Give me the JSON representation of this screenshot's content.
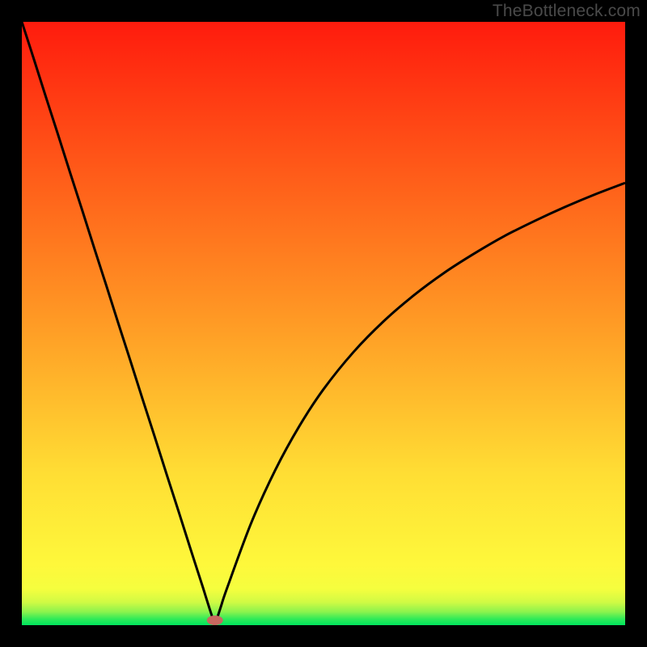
{
  "watermark": "TheBottleneck.com",
  "chart_data": {
    "type": "line",
    "title": "",
    "xlabel": "",
    "ylabel": "",
    "xlim": [
      0,
      100
    ],
    "ylim": [
      0,
      100
    ],
    "x": [
      0,
      2,
      4,
      6,
      8,
      10,
      12,
      14,
      16,
      18,
      20,
      22,
      24,
      26,
      28,
      30,
      31,
      32,
      33,
      34,
      38,
      42,
      46,
      50,
      55,
      60,
      65,
      70,
      75,
      80,
      85,
      90,
      95,
      100
    ],
    "y": [
      100,
      93.8,
      87.5,
      81.3,
      75.0,
      68.8,
      62.5,
      56.3,
      50.0,
      43.8,
      37.5,
      31.3,
      25.0,
      18.8,
      12.5,
      6.3,
      3.1,
      0.0,
      3.1,
      6.1,
      16.9,
      25.7,
      33.0,
      39.1,
      45.3,
      50.4,
      54.7,
      58.4,
      61.6,
      64.5,
      67.0,
      69.3,
      71.4,
      73.3
    ],
    "background_gradient_stops": [
      {
        "offset": 0.0,
        "color": "#00e55e"
      },
      {
        "offset": 0.01,
        "color": "#2eea58"
      },
      {
        "offset": 0.022,
        "color": "#8bf34d"
      },
      {
        "offset": 0.038,
        "color": "#d0fa44"
      },
      {
        "offset": 0.06,
        "color": "#f5fe3e"
      },
      {
        "offset": 0.1,
        "color": "#fef83b"
      },
      {
        "offset": 0.25,
        "color": "#ffde34"
      },
      {
        "offset": 0.5,
        "color": "#ff9b25"
      },
      {
        "offset": 0.75,
        "color": "#ff5b19"
      },
      {
        "offset": 1.0,
        "color": "#ff1b0d"
      }
    ],
    "minimum_marker": {
      "x": 32,
      "color": "#c86860"
    }
  }
}
